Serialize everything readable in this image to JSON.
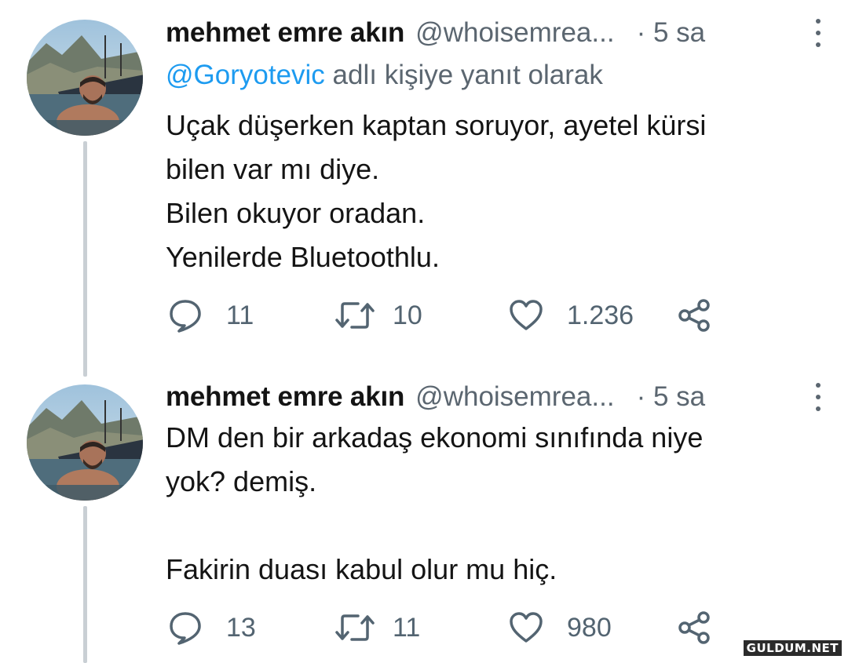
{
  "tweets": [
    {
      "author_name": "mehmet emre akın",
      "author_handle": "@whoisemrea...",
      "time": "· 5 sa",
      "reply_mention": "@Goryotevic",
      "reply_suffix": " adlı kişiye yanıt olarak",
      "text": "Uçak düşerken kaptan soruyor, ayetel kürsi\nbilen var mı diye.\nBilen okuyor oradan.\nYenilerde Bluetoothlu.",
      "replies": "11",
      "retweets": "10",
      "likes": "1.236"
    },
    {
      "author_name": "mehmet emre akın",
      "author_handle": "@whoisemrea...",
      "time": "· 5 sa",
      "text": "DM den bir arkadaş ekonomi sınıfında niye\nyok? demiş.\n\nFakirin duası kabul olur mu hiç.",
      "replies": "13",
      "retweets": "11",
      "likes": "980"
    }
  ],
  "icons": {
    "reply": "speech-bubble-icon",
    "retweet": "retweet-icon",
    "like": "heart-icon",
    "share": "share-icon",
    "more": "more-vertical-icon"
  },
  "colors": {
    "mention": "#1d9bf0",
    "secondary": "#536471",
    "thread_line": "#c9cfd4"
  },
  "watermark": "GULDUM.NET"
}
